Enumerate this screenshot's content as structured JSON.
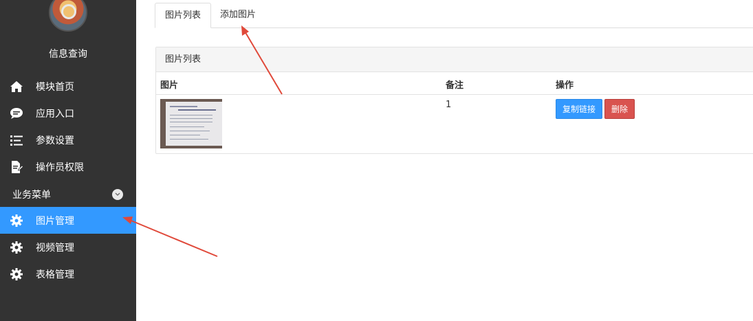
{
  "sidebar": {
    "site_title": "信息查询",
    "items": [
      {
        "label": "模块首页",
        "icon": "home-icon"
      },
      {
        "label": "应用入口",
        "icon": "chat-bubble-icon"
      },
      {
        "label": "参数设置",
        "icon": "list-icon"
      },
      {
        "label": "操作员权限",
        "icon": "document-edit-icon"
      }
    ],
    "section": {
      "label": "业务菜单",
      "icon": "chevron-down-icon"
    },
    "sub_items": [
      {
        "label": "图片管理",
        "icon": "gear-icon",
        "active": true
      },
      {
        "label": "视频管理",
        "icon": "gear-icon"
      },
      {
        "label": "表格管理",
        "icon": "gear-icon"
      }
    ]
  },
  "tabs": [
    {
      "label": "图片列表",
      "active": true
    },
    {
      "label": "添加图片"
    }
  ],
  "panel": {
    "title": "图片列表",
    "columns": [
      "图片",
      "备注",
      "操作"
    ],
    "rows": [
      {
        "note": "1",
        "actions": [
          "复制链接",
          "删除"
        ]
      }
    ]
  },
  "colors": {
    "sidebar_bg": "#333333",
    "active_bg": "#3399ff",
    "primary_button": "#3399ff",
    "danger_button": "#d9534f",
    "annotation_arrow": "#e0493a"
  }
}
